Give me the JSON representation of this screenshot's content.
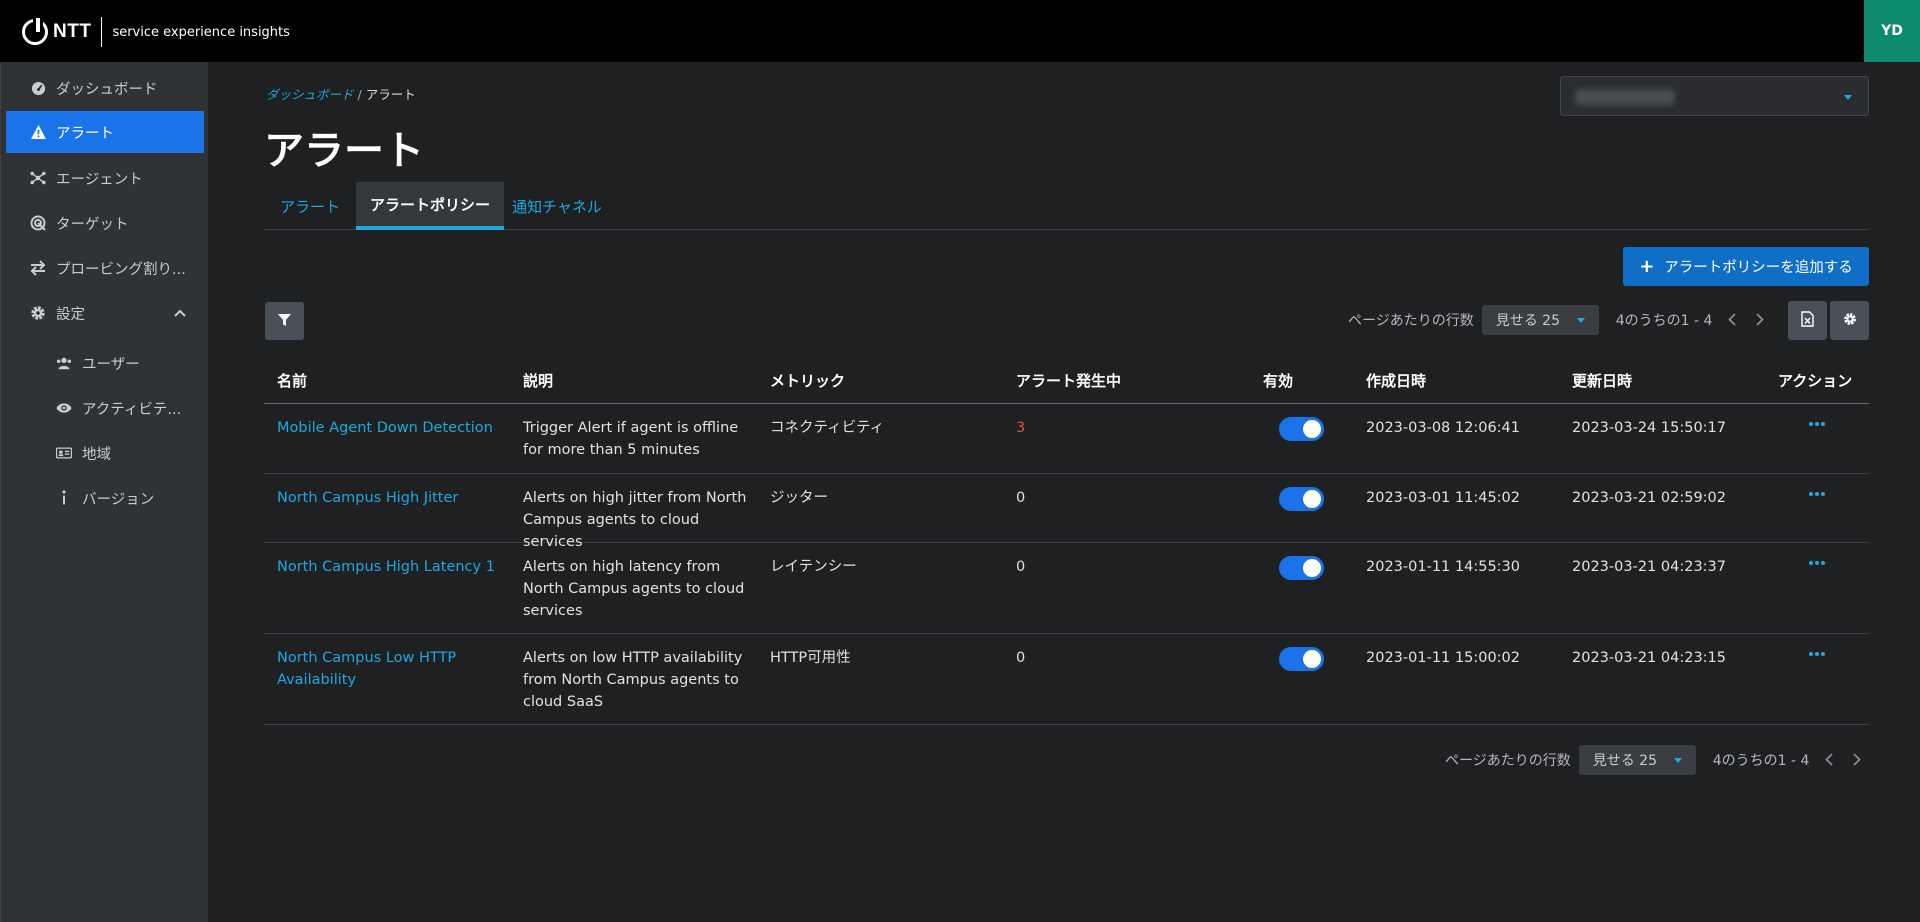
{
  "header": {
    "brand": "NTT",
    "product": "service experience insights",
    "user_initials": "YD"
  },
  "sidebar": {
    "items": [
      {
        "label": "ダッシュボード",
        "icon": "dashboard-icon"
      },
      {
        "label": "アラート",
        "icon": "warning-icon",
        "active": true
      },
      {
        "label": "エージェント",
        "icon": "agent-network-icon"
      },
      {
        "label": "ターゲット",
        "icon": "target-icon"
      },
      {
        "label": "プロービング割り...",
        "icon": "swap-icon"
      },
      {
        "label": "設定",
        "icon": "gear-icon",
        "expanded": true
      }
    ],
    "sub_items": [
      {
        "label": "ユーザー",
        "icon": "users-icon"
      },
      {
        "label": "アクティビテ...",
        "icon": "eye-icon"
      },
      {
        "label": "地域",
        "icon": "id-card-icon"
      },
      {
        "label": "バージョン",
        "icon": "info-icon"
      }
    ]
  },
  "breadcrumb": {
    "parent": "ダッシュボード",
    "separator": "/",
    "current": "アラート"
  },
  "page_title": "アラート",
  "tabs": [
    {
      "label": "アラート"
    },
    {
      "label": "アラートポリシー",
      "active": true
    },
    {
      "label": "通知チャネル"
    }
  ],
  "toolbar": {
    "add_label": "アラートポリシーを追加する"
  },
  "pagination": {
    "rows_per_page_label": "ページあたりの行数",
    "rows_select": "見せる 25",
    "range": "4のうちの1 - 4"
  },
  "table": {
    "headers": [
      "名前",
      "説明",
      "メトリック",
      "アラート発生中",
      "有効",
      "作成日時",
      "更新日時",
      "アクション"
    ],
    "rows": [
      {
        "name": "Mobile Agent Down Detection",
        "desc": "Trigger Alert if agent is offline for more than 5 minutes",
        "metric": "コネクティビティ",
        "active_alerts": "3",
        "enabled": true,
        "created": "2023-03-08 12:06:41",
        "updated": "2023-03-24 15:50:17"
      },
      {
        "name": "North Campus High Jitter",
        "desc": "Alerts on high jitter from North Campus agents to cloud services",
        "metric": "ジッター",
        "active_alerts": "0",
        "enabled": true,
        "created": "2023-03-01 11:45:02",
        "updated": "2023-03-21 02:59:02"
      },
      {
        "name": "North Campus High Latency 1",
        "desc": "Alerts on high latency from North Campus agents to cloud services",
        "metric": "レイテンシー",
        "active_alerts": "0",
        "enabled": true,
        "created": "2023-01-11 14:55:30",
        "updated": "2023-03-21 04:23:37"
      },
      {
        "name": "North Campus Low HTTP Availability",
        "desc": "Alerts on low HTTP availability from North Campus agents to cloud SaaS",
        "metric": "HTTP可用性",
        "active_alerts": "0",
        "enabled": true,
        "created": "2023-01-11 15:00:02",
        "updated": "2023-03-21 04:23:15"
      }
    ]
  },
  "colors": {
    "accent": "#1ea8e0",
    "primary_button": "#0f6fc6",
    "active_nav": "#1a73e8",
    "alert_count_nonzero": "#e8542f",
    "avatar": "#0e8a6e"
  }
}
